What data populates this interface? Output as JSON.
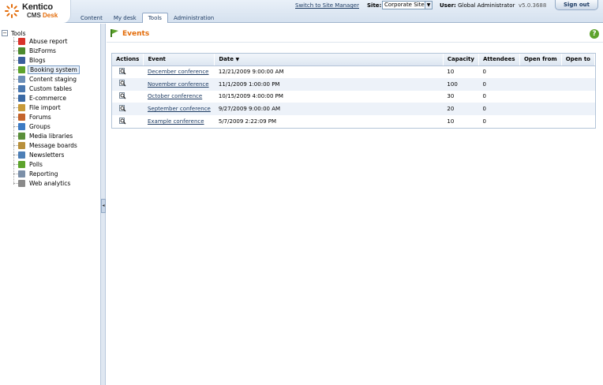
{
  "header": {
    "logo_name": "Kentico",
    "logo_product": "CMS",
    "logo_desk": "Desk",
    "tabs": [
      {
        "label": "Content"
      },
      {
        "label": "My desk"
      },
      {
        "label": "Tools"
      },
      {
        "label": "Administration"
      }
    ],
    "active_tab": "Tools",
    "switch_link": "Switch to Site Manager",
    "site_label": "Site:",
    "site_value": "Corporate Site",
    "user_label": "User:",
    "user_value": "Global Administrator",
    "version": "v5.0.3688",
    "signout_label": "Sign out"
  },
  "tree": {
    "root": "Tools",
    "items": [
      {
        "label": "Abuse report",
        "icon": "abuse-report-icon",
        "color": "#d9332b"
      },
      {
        "label": "BizForms",
        "icon": "bizforms-icon",
        "color": "#4c8a2d"
      },
      {
        "label": "Blogs",
        "icon": "blogs-icon",
        "color": "#3a5f9c"
      },
      {
        "label": "Booking system",
        "icon": "booking-system-icon",
        "color": "#5da32c"
      },
      {
        "label": "Content staging",
        "icon": "content-staging-icon",
        "color": "#6c8fb8"
      },
      {
        "label": "Custom tables",
        "icon": "custom-tables-icon",
        "color": "#4a78b0"
      },
      {
        "label": "E-commerce",
        "icon": "e-commerce-icon",
        "color": "#3b6aa5"
      },
      {
        "label": "File import",
        "icon": "file-import-icon",
        "color": "#c79a3a"
      },
      {
        "label": "Forums",
        "icon": "forums-icon",
        "color": "#c4632b"
      },
      {
        "label": "Groups",
        "icon": "groups-icon",
        "color": "#3d7bc4"
      },
      {
        "label": "Media libraries",
        "icon": "media-libraries-icon",
        "color": "#5a8f3a"
      },
      {
        "label": "Message boards",
        "icon": "message-boards-icon",
        "color": "#b8903c"
      },
      {
        "label": "Newsletters",
        "icon": "newsletters-icon",
        "color": "#4d7fb7"
      },
      {
        "label": "Polls",
        "icon": "polls-icon",
        "color": "#5da32c"
      },
      {
        "label": "Reporting",
        "icon": "reporting-icon",
        "color": "#7b8fa8"
      },
      {
        "label": "Web analytics",
        "icon": "web-analytics-icon",
        "color": "#8a8a8a"
      }
    ],
    "selected": "Booking system"
  },
  "page": {
    "title": "Events",
    "help_glyph": "?"
  },
  "grid": {
    "columns": [
      "Actions",
      "Event",
      "Date",
      "Capacity",
      "Attendees",
      "Open from",
      "Open to"
    ],
    "sort_column": "Date",
    "sort_glyph": "▼",
    "rows": [
      {
        "event": "December conference",
        "date": "12/21/2009 9:00:00 AM",
        "capacity": "10",
        "attendees": "0",
        "open_from": "",
        "open_to": ""
      },
      {
        "event": "November conference",
        "date": "11/1/2009 1:00:00 PM",
        "capacity": "100",
        "attendees": "0",
        "open_from": "",
        "open_to": ""
      },
      {
        "event": "October conference",
        "date": "10/15/2009 4:00:00 PM",
        "capacity": "30",
        "attendees": "0",
        "open_from": "",
        "open_to": ""
      },
      {
        "event": "September conference",
        "date": "9/27/2009 9:00:00 AM",
        "capacity": "20",
        "attendees": "0",
        "open_from": "",
        "open_to": ""
      },
      {
        "event": "Example conference",
        "date": "5/7/2009 2:22:09 PM",
        "capacity": "10",
        "attendees": "0",
        "open_from": "",
        "open_to": ""
      }
    ]
  },
  "colors": {
    "accent": "#e36c09",
    "link": "#1d3b63",
    "alt_row": "#edf2f9"
  }
}
